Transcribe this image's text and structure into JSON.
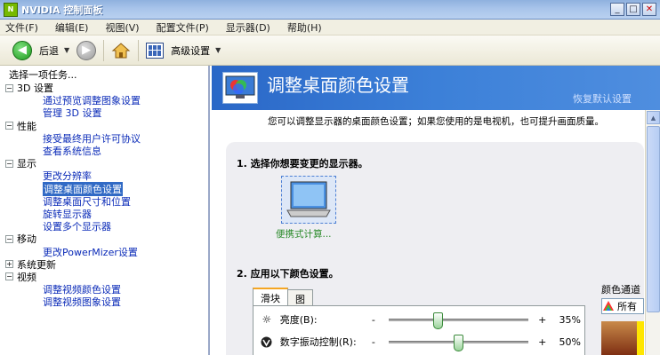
{
  "window": {
    "title": "NVIDIA 控制面板",
    "app_icon": "nvidia-icon"
  },
  "menu": [
    "文件(F)",
    "编辑(E)",
    "视图(V)",
    "配置文件(P)",
    "显示器(D)",
    "帮助(H)"
  ],
  "toolbar": {
    "back_label": "后退",
    "advanced_label": "高级设置"
  },
  "sidebar": {
    "header": "选择一项任务...",
    "groups": [
      {
        "label": "3D 设置",
        "expanded": true,
        "items": [
          "通过预览调整图象设置",
          "管理 3D 设置"
        ]
      },
      {
        "label": "性能",
        "expanded": true,
        "items": [
          "接受最终用户许可协议",
          "查看系统信息"
        ]
      },
      {
        "label": "显示",
        "expanded": true,
        "items": [
          "更改分辨率",
          "调整桌面颜色设置",
          "调整桌面尺寸和位置",
          "旋转显示器",
          "设置多个显示器"
        ]
      },
      {
        "label": "移动",
        "expanded": true,
        "items": [
          "更改PowerMizer设置"
        ]
      },
      {
        "label": "系统更新",
        "expanded": false,
        "items": []
      },
      {
        "label": "视频",
        "expanded": true,
        "items": [
          "调整视频颜色设置",
          "调整视频图象设置"
        ]
      }
    ],
    "selected": "调整桌面颜色设置"
  },
  "main": {
    "title": "调整桌面颜色设置",
    "restore": "恢复默认设置",
    "intro": "您可以调整显示器的桌面颜色设置；如果您使用的是电视机，也可提升画面质量。",
    "step1": "1. 选择你想要变更的显示器。",
    "monitor_label": "便携式计算...",
    "step2": "2. 应用以下颜色设置。",
    "tabs": [
      "滑块",
      "图"
    ],
    "sliders": [
      {
        "label": "亮度(B):",
        "minus": "-",
        "plus": "+",
        "value": 35,
        "value_text": "35%",
        "icon": "sun-icon"
      },
      {
        "label": "数字振动控制(R):",
        "minus": "-",
        "plus": "+",
        "value": 50,
        "value_text": "50%",
        "icon": "vibrance-icon"
      }
    ],
    "color_channel": {
      "label": "颜色通道",
      "selected": "所有"
    }
  }
}
